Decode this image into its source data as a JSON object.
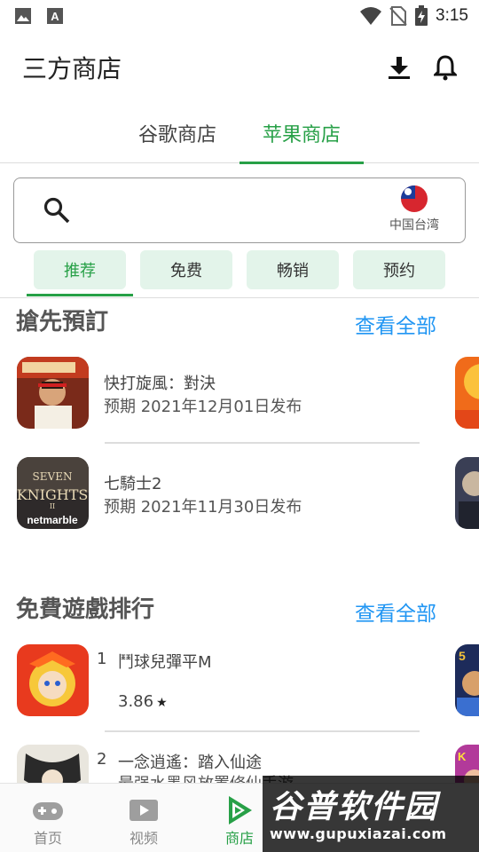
{
  "status_bar": {
    "time": "3:15",
    "left_icons": [
      "image-icon",
      "font-icon"
    ],
    "right_icons": [
      "wifi-icon",
      "no-sim-icon",
      "battery-charging-icon"
    ]
  },
  "header": {
    "title": "三方商店",
    "download_icon": "download-icon",
    "bell_icon": "bell-icon"
  },
  "store_tabs": [
    {
      "label": "谷歌商店",
      "active": false
    },
    {
      "label": "苹果商店",
      "active": true
    }
  ],
  "search": {
    "placeholder": "",
    "region_label": "中国台湾"
  },
  "chips": [
    {
      "label": "推荐",
      "active": true
    },
    {
      "label": "免费",
      "active": false
    },
    {
      "label": "畅销",
      "active": false
    },
    {
      "label": "预约",
      "active": false
    }
  ],
  "sections": {
    "preorder": {
      "title": "搶先預訂",
      "see_all": "查看全部",
      "apps": [
        {
          "name": "快打旋風：對決",
          "sub": "预期 2021年12月01日发布"
        },
        {
          "name": "七騎士2",
          "sub": "预期 2021年11月30日发布"
        }
      ]
    },
    "free_ranking": {
      "title": "免費遊戲排行",
      "see_all": "查看全部",
      "apps": [
        {
          "rank": "1",
          "name": "鬥球兒彈平M",
          "rating": "3.86",
          "sub": ""
        },
        {
          "rank": "2",
          "name": "一念逍遙：踏入仙途",
          "rating": "",
          "sub": "最强水墨风放置修仙手游"
        }
      ]
    }
  },
  "bottom_nav": [
    {
      "label": "首页",
      "icon": "gamepad-icon",
      "active": false
    },
    {
      "label": "视频",
      "icon": "video-icon",
      "active": false
    },
    {
      "label": "商店",
      "icon": "play-store-icon",
      "active": true
    }
  ],
  "watermark": {
    "title": "谷普软件园",
    "url": "www.gupuxiazai.com"
  },
  "colors": {
    "accent": "#27a047",
    "link": "#2196f3",
    "chip_bg": "#e3f4ea"
  }
}
